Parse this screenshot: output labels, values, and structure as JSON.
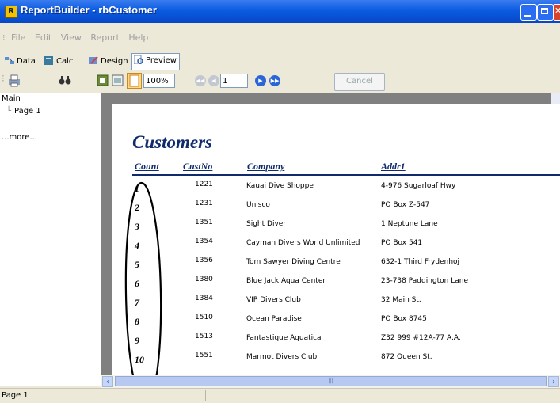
{
  "window": {
    "title": "ReportBuilder - rbCustomer",
    "icon_letter": "R"
  },
  "menu": [
    "File",
    "Edit",
    "View",
    "Report",
    "Help"
  ],
  "tabs": [
    {
      "label": "Data",
      "active": false
    },
    {
      "label": "Calc",
      "active": false
    },
    {
      "label": "Design",
      "active": false
    },
    {
      "label": "Preview",
      "active": true
    }
  ],
  "toolbar": {
    "zoom": "100%",
    "page": "1",
    "cancel": "Cancel"
  },
  "tree": {
    "root": "Main",
    "child": "Page 1",
    "more": "...more..."
  },
  "report": {
    "title": "Customers",
    "headers": [
      "Count",
      "CustNo",
      "Company",
      "Addr1"
    ],
    "rows": [
      {
        "count": "1",
        "custno": "1221",
        "company": "Kauai Dive Shoppe",
        "addr1": "4-976 Sugarloaf Hwy"
      },
      {
        "count": "2",
        "custno": "1231",
        "company": "Unisco",
        "addr1": "PO Box Z-547"
      },
      {
        "count": "3",
        "custno": "1351",
        "company": "Sight Diver",
        "addr1": "1 Neptune Lane"
      },
      {
        "count": "4",
        "custno": "1354",
        "company": "Cayman Divers World Unlimited",
        "addr1": "PO Box 541"
      },
      {
        "count": "5",
        "custno": "1356",
        "company": "Tom Sawyer Diving Centre",
        "addr1": "632-1 Third Frydenhoj"
      },
      {
        "count": "6",
        "custno": "1380",
        "company": "Blue Jack Aqua Center",
        "addr1": "23-738 Paddington Lane"
      },
      {
        "count": "7",
        "custno": "1384",
        "company": "VIP Divers Club",
        "addr1": "32 Main St."
      },
      {
        "count": "8",
        "custno": "1510",
        "company": "Ocean Paradise",
        "addr1": "PO Box 8745"
      },
      {
        "count": "9",
        "custno": "1513",
        "company": "Fantastique Aquatica",
        "addr1": "Z32 999 #12A-77 A.A."
      },
      {
        "count": "10",
        "custno": "1551",
        "company": "Marmot Divers Club",
        "addr1": "872 Queen St."
      }
    ]
  },
  "status": {
    "text": "Page 1"
  }
}
